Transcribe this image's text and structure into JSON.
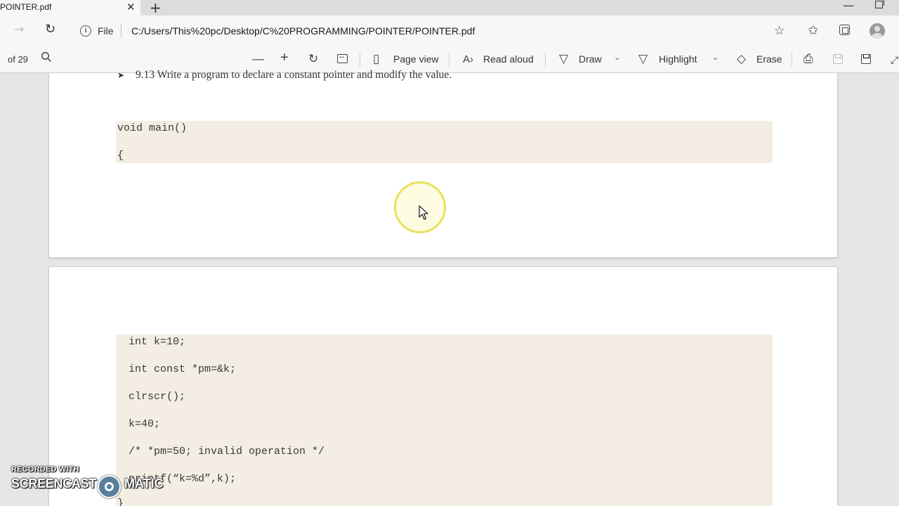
{
  "browser": {
    "tab_title": "POINTER.pdf",
    "tab_close": "✕",
    "new_tab": "+",
    "minimize": "—",
    "address": {
      "site_info": "File",
      "url": "C:/Users/This%20pc/Desktop/C%20PROGRAMMING/POINTER/POINTER.pdf"
    }
  },
  "pdf_toolbar": {
    "page_count": "of 29",
    "page_view_label": "Page view",
    "read_aloud_label": "Read aloud",
    "draw_label": "Draw",
    "highlight_label": "Highlight",
    "erase_label": "Erase"
  },
  "document": {
    "page1": {
      "question_bullet": "➤",
      "question": "9.13  Write a program to declare a constant pointer and modify the value.",
      "code_lines": [
        "void main()",
        "{"
      ]
    },
    "page2": {
      "code_lines": [
        "int k=10;",
        "int const *pm=&k;",
        "clrscr();",
        "k=40;",
        "/* *pm=50; invalid operation */",
        "printf(“k=%d”,k);",
        "}"
      ]
    }
  },
  "watermark": {
    "recorded_with": "RECORDED WITH",
    "brand_left": "SCREENCAST",
    "brand_right": "MATIC"
  },
  "colors": {
    "code_background": "#f3ede4",
    "cursor_highlight": "#e8e15c"
  }
}
